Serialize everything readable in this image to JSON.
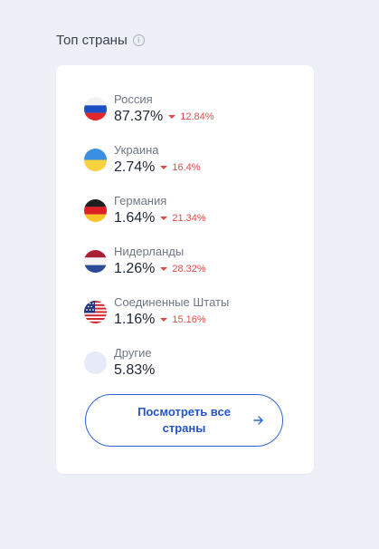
{
  "section": {
    "title": "Топ страны",
    "info_icon": "info-icon"
  },
  "countries": [
    {
      "name": "Россия",
      "share": "87.37%",
      "change": "12.84%",
      "direction": "down",
      "flag_icon": "russia-flag-icon"
    },
    {
      "name": "Украина",
      "share": "2.74%",
      "change": "16.4%",
      "direction": "down",
      "flag_icon": "ukraine-flag-icon"
    },
    {
      "name": "Германия",
      "share": "1.64%",
      "change": "21.34%",
      "direction": "down",
      "flag_icon": "germany-flag-icon"
    },
    {
      "name": "Нидерланды",
      "share": "1.26%",
      "change": "28.32%",
      "direction": "down",
      "flag_icon": "netherlands-flag-icon"
    },
    {
      "name": "Соединенные Штаты",
      "share": "1.16%",
      "change": "15.16%",
      "direction": "down",
      "flag_icon": "usa-flag-icon"
    }
  ],
  "other": {
    "name": "Другие",
    "share": "5.83%"
  },
  "cta": {
    "label": "Посмотреть все страны",
    "icon": "arrow-right-icon"
  },
  "colors": {
    "accent": "#2c63d6",
    "negative": "#e24a4a",
    "background": "#eef0f8"
  }
}
